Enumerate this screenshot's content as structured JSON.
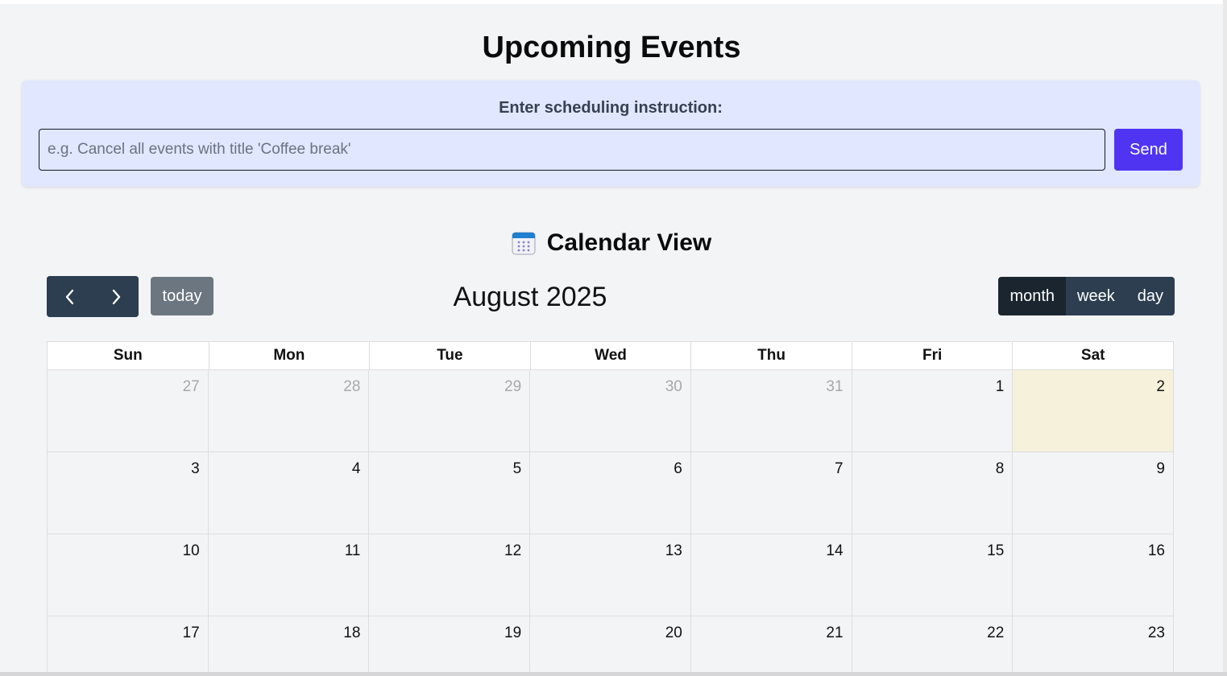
{
  "header": {
    "title": "Upcoming Events"
  },
  "instruction": {
    "label": "Enter scheduling instruction:",
    "placeholder": "e.g. Cancel all events with title 'Coffee break'",
    "value": "",
    "send_label": "Send"
  },
  "calendar": {
    "heading_icon": "calendar-icon",
    "heading": "Calendar View",
    "toolbar": {
      "prev_icon": "chevron-left-icon",
      "next_icon": "chevron-right-icon",
      "prev_glyph": "‹",
      "next_glyph": "›",
      "today_label": "today",
      "title": "August 2025",
      "views": [
        {
          "label": "month",
          "active": true
        },
        {
          "label": "week",
          "active": false
        },
        {
          "label": "day",
          "active": false
        }
      ]
    },
    "weekdays": [
      "Sun",
      "Mon",
      "Tue",
      "Wed",
      "Thu",
      "Fri",
      "Sat"
    ],
    "weeks": [
      [
        "27",
        "28",
        "29",
        "30",
        "31",
        "1",
        "2"
      ],
      [
        "3",
        "4",
        "5",
        "6",
        "7",
        "8",
        "9"
      ],
      [
        "10",
        "11",
        "12",
        "13",
        "14",
        "15",
        "16"
      ],
      [
        "17",
        "18",
        "19",
        "20",
        "21",
        "22",
        "23"
      ]
    ],
    "today": "2",
    "colors": {
      "accent": "#4f35f2",
      "toolbar_button": "#2c3e50",
      "today_highlight": "#f5f1db",
      "panel_bg": "#e0e7ff"
    }
  }
}
